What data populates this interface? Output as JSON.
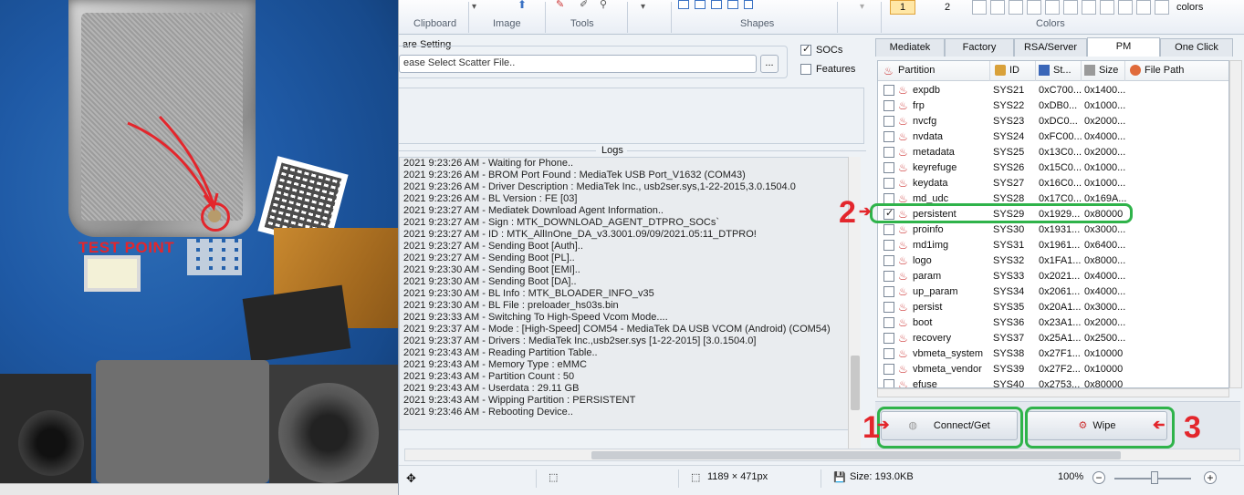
{
  "photo": {
    "test_point_label": "TEST POINT"
  },
  "ribbon": {
    "groups": [
      "Clipboard",
      "Image",
      "Tools",
      "Shapes",
      "Colors"
    ],
    "color_numbers": [
      "1",
      "2"
    ],
    "colors_label": "colors"
  },
  "left": {
    "scatter_title": "are Setting",
    "scatter_placeholder": "ease Select Scatter File..",
    "browse_label": "...",
    "socs_label": "SOCs",
    "features_label": "Features",
    "logs_title": "Logs",
    "logs": [
      "2021 9:23:26 AM - Waiting for Phone..",
      "2021 9:23:26 AM - BROM Port Found : MediaTek USB Port_V1632 (COM43)",
      "2021 9:23:26 AM - Driver Description : MediaTek Inc., usb2ser.sys,1-22-2015,3.0.1504.0",
      "2021 9:23:26 AM - BL Version : FE [03]",
      "2021 9:23:27 AM - Mediatek Download Agent Information..",
      "2021 9:23:27 AM - Sign : MTK_DOWNLOAD_AGENT_DTPRO_SOCs`",
      "2021 9:23:27 AM - ID : MTK_AllInOne_DA_v3.3001.09/09/2021.05:11_DTPRO!",
      "2021 9:23:27 AM - Sending Boot [Auth]..",
      "2021 9:23:27 AM - Sending Boot [PL]..",
      "2021 9:23:30 AM - Sending Boot [EMI]..",
      "2021 9:23:30 AM - Sending Boot [DA]..",
      "2021 9:23:30 AM - BL Info : MTK_BLOADER_INFO_v35",
      "2021 9:23:30 AM - BL File : preloader_hs03s.bin",
      "2021 9:23:33 AM - Switching To High-Speed Vcom Mode....",
      "2021 9:23:37 AM - Mode : [High-Speed] COM54 - MediaTek DA USB VCOM (Android) (COM54)",
      "2021 9:23:37 AM - Drivers : MediaTek Inc.,usb2ser.sys [1-22-2015] [3.0.1504.0]",
      "2021 9:23:43 AM - Reading Partition Table..",
      "2021 9:23:43 AM - Memory Type : eMMC",
      "2021 9:23:43 AM - Partition Count : 50",
      "2021 9:23:43 AM - Userdata : 29.11 GB",
      "2021 9:23:43 AM - Wipping Partition : PERSISTENT",
      "2021 9:23:46 AM - Rebooting Device.."
    ]
  },
  "tabs": [
    "Mediatek",
    "Factory",
    "RSA/Server",
    "PM",
    "One Click"
  ],
  "grid": {
    "headers": [
      "Partition",
      "ID",
      "St...",
      "Size",
      "File Path"
    ],
    "rows": [
      {
        "name": "expdb",
        "id": "SYS21",
        "start": "0xC700...",
        "size": "0x1400...",
        "checked": false
      },
      {
        "name": "frp",
        "id": "SYS22",
        "start": "0xDB0...",
        "size": "0x1000...",
        "checked": false
      },
      {
        "name": "nvcfg",
        "id": "SYS23",
        "start": "0xDC0...",
        "size": "0x2000...",
        "checked": false
      },
      {
        "name": "nvdata",
        "id": "SYS24",
        "start": "0xFC00...",
        "size": "0x4000...",
        "checked": false
      },
      {
        "name": "metadata",
        "id": "SYS25",
        "start": "0x13C0...",
        "size": "0x2000...",
        "checked": false
      },
      {
        "name": "keyrefuge",
        "id": "SYS26",
        "start": "0x15C0...",
        "size": "0x1000...",
        "checked": false
      },
      {
        "name": "keydata",
        "id": "SYS27",
        "start": "0x16C0...",
        "size": "0x1000...",
        "checked": false
      },
      {
        "name": "md_udc",
        "id": "SYS28",
        "start": "0x17C0...",
        "size": "0x169A...",
        "checked": false
      },
      {
        "name": "persistent",
        "id": "SYS29",
        "start": "0x1929...",
        "size": "0x80000",
        "checked": true
      },
      {
        "name": "proinfo",
        "id": "SYS30",
        "start": "0x1931...",
        "size": "0x3000...",
        "checked": false
      },
      {
        "name": "md1img",
        "id": "SYS31",
        "start": "0x1961...",
        "size": "0x6400...",
        "checked": false
      },
      {
        "name": "logo",
        "id": "SYS32",
        "start": "0x1FA1...",
        "size": "0x8000...",
        "checked": false
      },
      {
        "name": "param",
        "id": "SYS33",
        "start": "0x2021...",
        "size": "0x4000...",
        "checked": false
      },
      {
        "name": "up_param",
        "id": "SYS34",
        "start": "0x2061...",
        "size": "0x4000...",
        "checked": false
      },
      {
        "name": "persist",
        "id": "SYS35",
        "start": "0x20A1...",
        "size": "0x3000...",
        "checked": false
      },
      {
        "name": "boot",
        "id": "SYS36",
        "start": "0x23A1...",
        "size": "0x2000...",
        "checked": false
      },
      {
        "name": "recovery",
        "id": "SYS37",
        "start": "0x25A1...",
        "size": "0x2500...",
        "checked": false
      },
      {
        "name": "vbmeta_system",
        "id": "SYS38",
        "start": "0x27F1...",
        "size": "0x10000",
        "checked": false
      },
      {
        "name": "vbmeta_vendor",
        "id": "SYS39",
        "start": "0x27F2...",
        "size": "0x10000",
        "checked": false
      },
      {
        "name": "efuse",
        "id": "SYS40",
        "start": "0x2753...",
        "size": "0x80000",
        "checked": false
      }
    ]
  },
  "actions": {
    "connect_label": "Connect/Get",
    "wipe_label": "Wipe"
  },
  "annotations": {
    "step1": "1",
    "step2": "2",
    "step3": "3",
    "color": "#e3262c",
    "box_color": "#2fb34a"
  },
  "status": {
    "dimensions": "1189 × 471px",
    "size": "Size: 193.0KB",
    "zoom": "100%",
    "zoom_minus": "−",
    "zoom_plus": "+"
  }
}
